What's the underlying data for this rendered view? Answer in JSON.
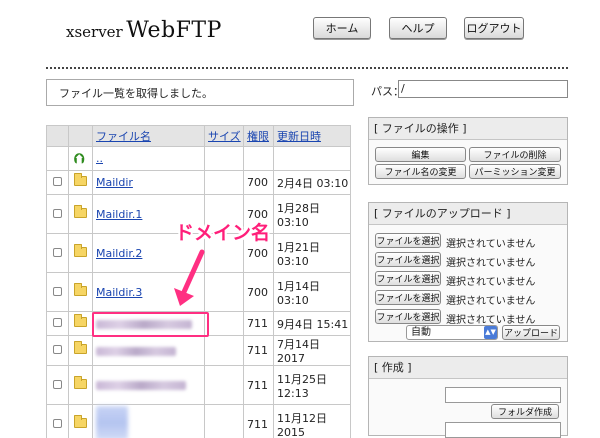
{
  "header": {
    "logo_small": "xserver",
    "logo_big": "WebFTP",
    "home_label": "ホーム",
    "help_label": "ヘルプ",
    "logout_label": "ログアウト"
  },
  "status": {
    "message": "ファイル一覧を取得しました。"
  },
  "path": {
    "label": "パス：",
    "value": "/"
  },
  "table": {
    "headers": {
      "name": "ファイル名",
      "size": "サイズ",
      "perm": "権限",
      "date": "更新日時"
    },
    "parent": "..",
    "rows": [
      {
        "name": "Maildir",
        "perm": "700",
        "date": "2月4日 03:10"
      },
      {
        "name": "Maildir.1",
        "perm": "700",
        "date": "1月28日 03:10"
      },
      {
        "name": "Maildir.2",
        "perm": "700",
        "date": "1月21日 03:10"
      },
      {
        "name": "Maildir.3",
        "perm": "700",
        "date": "1月14日 03:10"
      },
      {
        "name": "",
        "perm": "711",
        "date": "9月4日 15:41"
      },
      {
        "name": "",
        "perm": "711",
        "date": "7月14日 2017"
      },
      {
        "name": "",
        "perm": "711",
        "date": "11月25日 12:13"
      },
      {
        "name": "",
        "perm": "711",
        "date": "11月12日 2015"
      }
    ]
  },
  "annotation": {
    "label": "ドメイン名",
    "color": "#ff2f82"
  },
  "file_ops": {
    "title": "[ ファイルの操作 ]",
    "edit": "編集",
    "delete": "ファイルの削除",
    "rename": "ファイル名の変更",
    "permission": "パーミッション変更"
  },
  "upload": {
    "title": "[ ファイルのアップロード ]",
    "choose_label": "ファイルを選択",
    "none_selected": "選択されていません",
    "mode_value": "自動",
    "upload_button": "アップロード"
  },
  "create": {
    "title": "[ 作成 ]",
    "folder_button": "フォルダ作成"
  }
}
